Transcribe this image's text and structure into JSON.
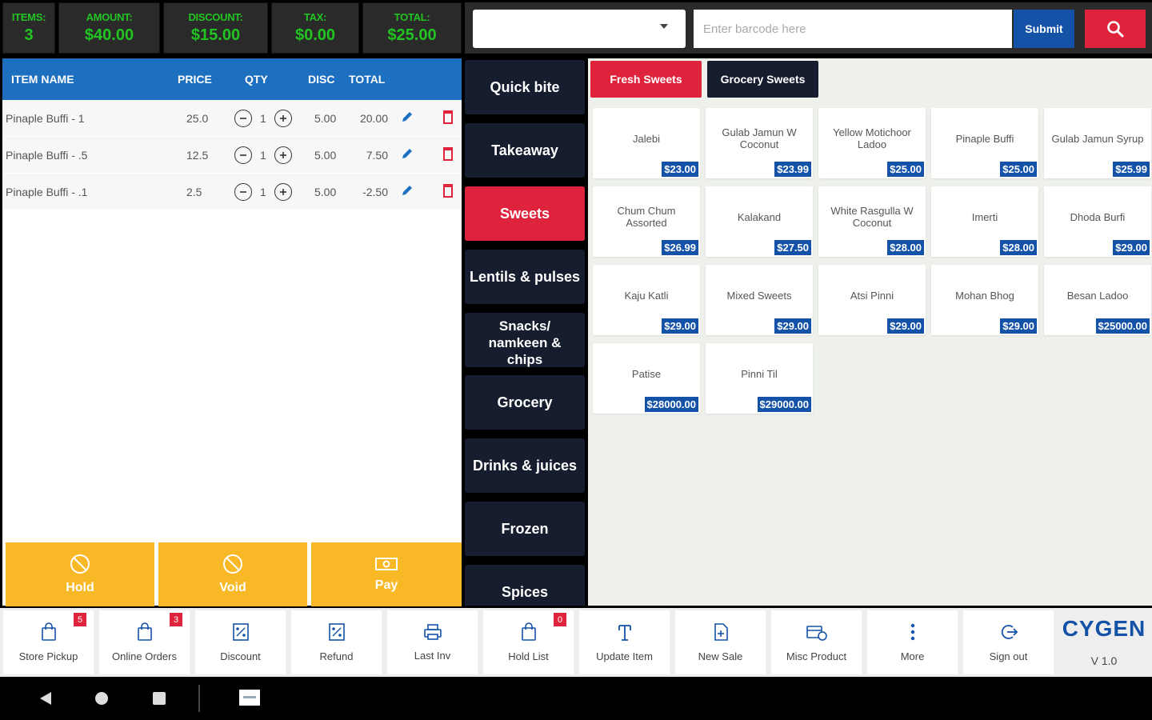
{
  "summary": {
    "items_label": "ITEMS:",
    "items_value": "3",
    "amount_label": "AMOUNT:",
    "amount_value": "$40.00",
    "discount_label": "DISCOUNT:",
    "discount_value": "$15.00",
    "tax_label": "TAX:",
    "tax_value": "$0.00",
    "total_label": "TOTAL:",
    "total_value": "$25.00"
  },
  "search": {
    "dropdown_value": "",
    "barcode_placeholder": "Enter barcode here",
    "submit_label": "Submit"
  },
  "cart": {
    "headers": {
      "name": "ITEM NAME",
      "price": "PRICE",
      "qty": "QTY",
      "disc": "DISC",
      "total": "TOTAL"
    },
    "rows": [
      {
        "name": "Pinaple Buffi - 1",
        "price": "25.0",
        "qty": "1",
        "disc": "5.00",
        "total": "20.00"
      },
      {
        "name": "Pinaple Buffi - .5",
        "price": "12.5",
        "qty": "1",
        "disc": "5.00",
        "total": "7.50"
      },
      {
        "name": "Pinaple Buffi - .1",
        "price": "2.5",
        "qty": "1",
        "disc": "5.00",
        "total": "-2.50"
      }
    ]
  },
  "actions": {
    "hold": "Hold",
    "void": "Void",
    "pay": "Pay"
  },
  "categories": [
    {
      "label": "Quick bite",
      "active": false
    },
    {
      "label": "Takeaway",
      "active": false
    },
    {
      "label": "Sweets",
      "active": true
    },
    {
      "label": "Lentils & pulses",
      "active": false
    },
    {
      "label": "Snacks/ namkeen & chips",
      "active": false
    },
    {
      "label": "Grocery",
      "active": false
    },
    {
      "label": "Drinks & juices",
      "active": false
    },
    {
      "label": "Frozen",
      "active": false
    },
    {
      "label": "Spices",
      "active": false
    }
  ],
  "subcategories": [
    {
      "label": "Fresh Sweets",
      "color": "#e0233c"
    },
    {
      "label": "Grocery Sweets",
      "color": "#151d2e"
    }
  ],
  "products": [
    {
      "name": "Jalebi",
      "price": "$23.00"
    },
    {
      "name": "Gulab Jamun W Coconut",
      "price": "$23.99"
    },
    {
      "name": "Yellow Motichoor Ladoo",
      "price": "$25.00"
    },
    {
      "name": "Pinaple Buffi",
      "price": "$25.00"
    },
    {
      "name": "Gulab Jamun Syrup",
      "price": "$25.99"
    },
    {
      "name": "Chum Chum Assorted",
      "price": "$26.99"
    },
    {
      "name": "Kalakand",
      "price": "$27.50"
    },
    {
      "name": "White Rasgulla W Coconut",
      "price": "$28.00"
    },
    {
      "name": "Imerti",
      "price": "$28.00"
    },
    {
      "name": "Dhoda Burfi",
      "price": "$29.00"
    },
    {
      "name": "Kaju Katli",
      "price": "$29.00"
    },
    {
      "name": "Mixed Sweets",
      "price": "$29.00"
    },
    {
      "name": "Atsi Pinni",
      "price": "$29.00"
    },
    {
      "name": "Mohan Bhog",
      "price": "$29.00"
    },
    {
      "name": "Besan Ladoo",
      "price": "$25000.00"
    },
    {
      "name": "Patise",
      "price": "$28000.00"
    },
    {
      "name": "Pinni Til",
      "price": "$29000.00"
    }
  ],
  "toolbar": [
    {
      "label": "Store Pickup",
      "icon": "shopping-bag-icon",
      "badge": "5"
    },
    {
      "label": "Online Orders",
      "icon": "shopping-bag-icon",
      "badge": "3"
    },
    {
      "label": "Discount",
      "icon": "discount-icon",
      "badge": ""
    },
    {
      "label": "Refund",
      "icon": "refund-icon",
      "badge": ""
    },
    {
      "label": "Last Inv",
      "icon": "printer-icon",
      "badge": ""
    },
    {
      "label": "Hold List",
      "icon": "shopping-bag-icon",
      "badge": "0"
    },
    {
      "label": "Update Item",
      "icon": "update-item-icon",
      "badge": ""
    },
    {
      "label": "New Sale",
      "icon": "new-document-icon",
      "badge": ""
    },
    {
      "label": "Misc Product",
      "icon": "misc-product-icon",
      "badge": ""
    },
    {
      "label": "More",
      "icon": "more-vertical-icon",
      "badge": ""
    },
    {
      "label": "Sign out",
      "icon": "sign-out-icon",
      "badge": ""
    }
  ],
  "brand": {
    "logo": "CYGEN",
    "version": "V 1.0"
  },
  "colors": {
    "accent_blue": "#1452a8",
    "accent_red": "#e0233c",
    "action_yellow": "#f9b826",
    "summary_green": "#22c422",
    "category_dark": "#151d2e"
  }
}
